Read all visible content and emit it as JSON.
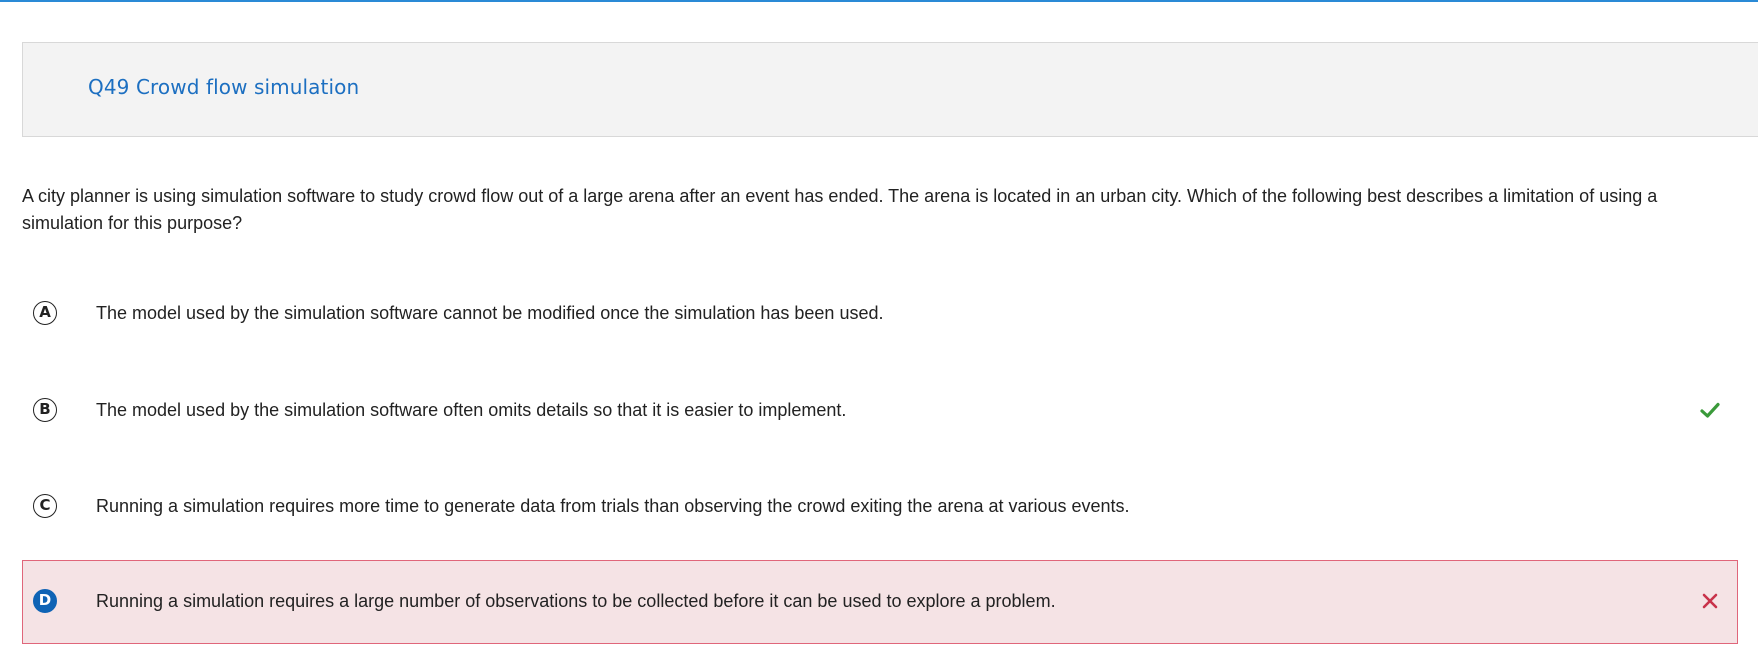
{
  "question": {
    "title": "Q49 Crowd flow simulation",
    "prompt": "A city planner is using simulation software to study crowd flow out of a large arena after an event has ended. The arena is located in an urban city. Which of the following best describes a limitation of using a simulation for this purpose?"
  },
  "choices": [
    {
      "letter": "A",
      "text": "The model used by the simulation software cannot be modified once the simulation has been used.",
      "status": "none"
    },
    {
      "letter": "B",
      "text": "The model used by the simulation software often omits details so that it is easier to implement.",
      "status": "correct",
      "status_icon": "checkmark-icon"
    },
    {
      "letter": "C",
      "text": "Running a simulation requires more time to generate data from trials than observing the crowd exiting the arena at various events.",
      "status": "none"
    },
    {
      "letter": "D",
      "text": "Running a simulation requires a large number of observations to be collected before it can be used to explore a problem.",
      "status": "incorrect-selected",
      "status_icon": "x-mark-icon"
    }
  ],
  "colors": {
    "accent": "#1c6fc1",
    "correct": "#3a9a3a",
    "incorrect": "#c8324a",
    "incorrect_bg": "#f5e3e5",
    "selected_badge": "#0f63b5"
  }
}
